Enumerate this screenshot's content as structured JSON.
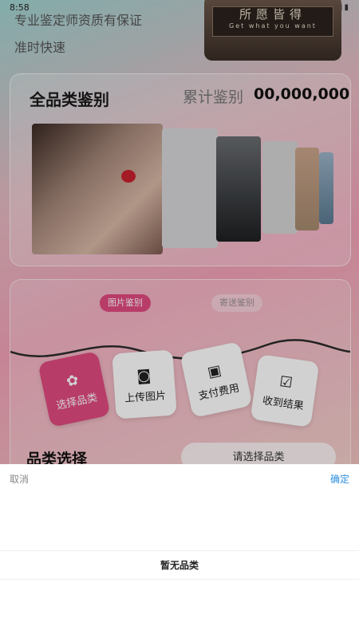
{
  "status_bar": {
    "time": "8:58"
  },
  "promo": {
    "line1": "专业鉴定师资质有保证",
    "line2": "准时快速"
  },
  "banner": {
    "sign_cn": "所愿皆得",
    "sign_en": "Get what you want"
  },
  "overview": {
    "title": "全品类鉴别",
    "stat_label": "累计鉴别",
    "stat_value": "00,000,000"
  },
  "tabs": [
    {
      "label": "图片鉴别",
      "active": true
    },
    {
      "label": "寄送鉴别",
      "active": false
    }
  ],
  "steps": [
    {
      "label": "选择品类",
      "icon": "clover-icon"
    },
    {
      "label": "上传图片",
      "icon": "camera-icon"
    },
    {
      "label": "支付费用",
      "icon": "wallet-icon"
    },
    {
      "label": "收到结果",
      "icon": "clipboard-check-icon"
    }
  ],
  "category": {
    "title": "品类选择",
    "select_placeholder": "请选择品类"
  },
  "picker": {
    "cancel": "取消",
    "confirm": "确定",
    "empty_text": "暂无品类"
  },
  "colors": {
    "accent": "#e14a7f",
    "confirm_blue": "#2a8fe0"
  }
}
